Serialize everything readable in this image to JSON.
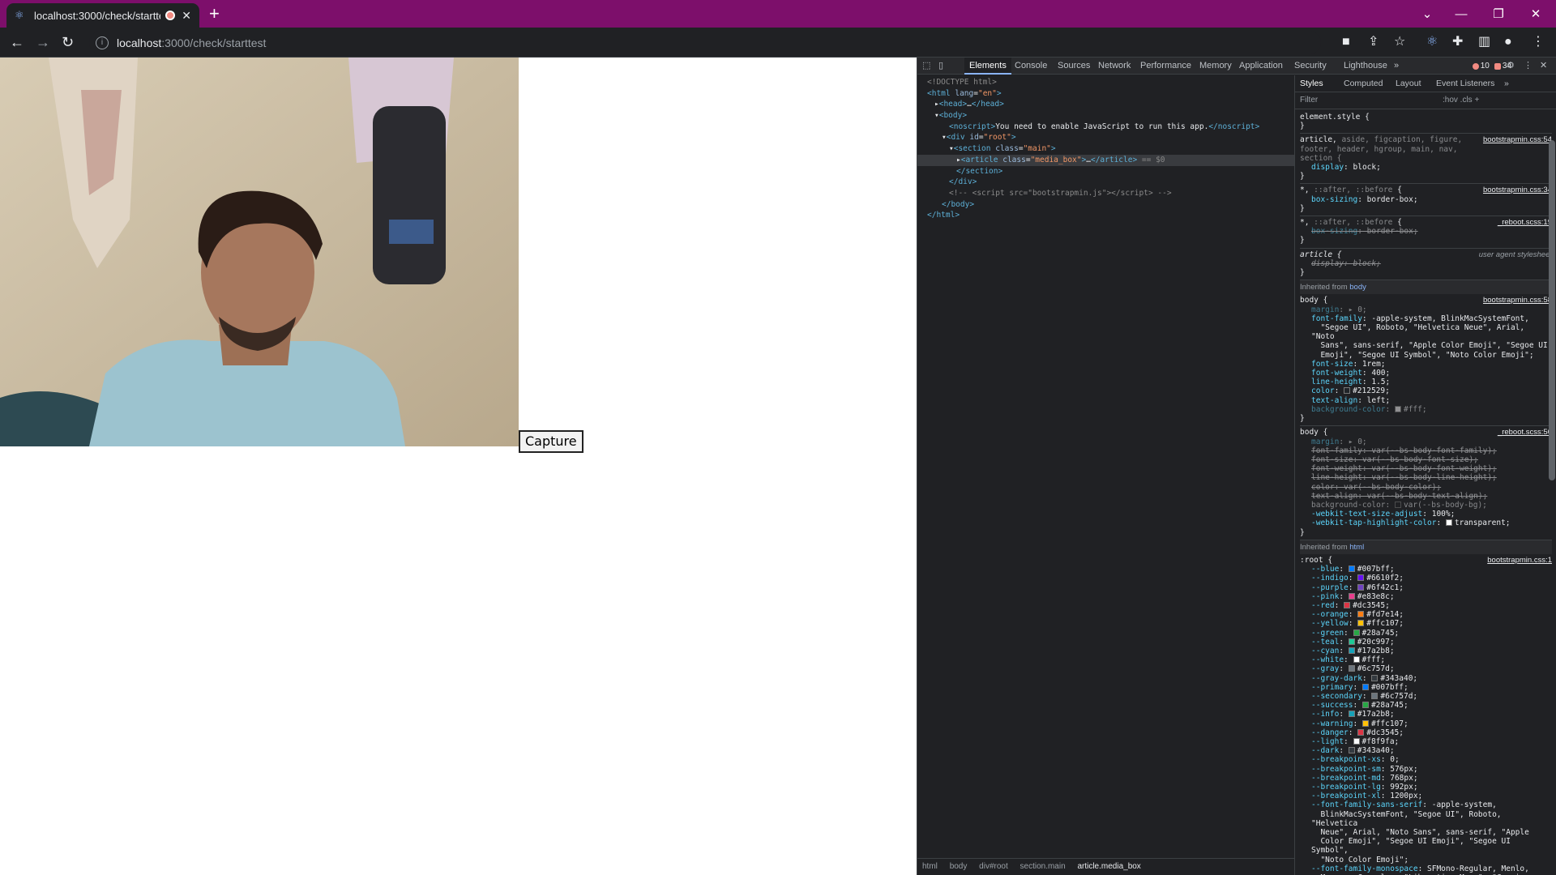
{
  "browser": {
    "tab_title": "localhost:3000/check/startte",
    "new_tab": "+",
    "url_host": "localhost",
    "url_path": ":3000/check/starttest"
  },
  "page": {
    "capture_label": "Capture"
  },
  "devtools": {
    "tabs": [
      "Elements",
      "Console",
      "Sources",
      "Network",
      "Performance",
      "Memory",
      "Application",
      "Security",
      "Lighthouse",
      "»"
    ],
    "errors": "10",
    "warnings": "34",
    "dom": [
      {
        "indent": 0,
        "html": "<span class='cm'>&lt;!DOCTYPE html&gt;</span>"
      },
      {
        "indent": 0,
        "html": "<span class='tag'>&lt;html</span> <span class='att'>lang</span>=<span class='val'>\"en\"</span><span class='tag'>&gt;</span>"
      },
      {
        "indent": 1,
        "html": "▸<span class='tag'>&lt;head&gt;</span>…<span class='tag'>&lt;/head&gt;</span>"
      },
      {
        "indent": 1,
        "html": "▾<span class='tag'>&lt;body&gt;</span>"
      },
      {
        "indent": 3,
        "html": "<span class='tag'>&lt;noscript&gt;</span><span class='txt'>You need to enable JavaScript to run this app.</span><span class='tag'>&lt;/noscript&gt;</span>"
      },
      {
        "indent": 2,
        "html": "▾<span class='tag'>&lt;div</span> <span class='att'>id</span>=<span class='val'>\"root\"</span><span class='tag'>&gt;</span>"
      },
      {
        "indent": 3,
        "html": "▾<span class='tag'>&lt;section</span> <span class='att'>class</span>=<span class='val'>\"main\"</span><span class='tag'>&gt;</span>"
      },
      {
        "indent": 4,
        "html": "▸<span class='tag'>&lt;article</span> <span class='att'>class</span>=<span class='val'>\"media_box\"</span><span class='tag'>&gt;</span>…<span class='tag'>&lt;/article&gt;</span> <span class='cm'>== $0</span>",
        "selected": true
      },
      {
        "indent": 4,
        "html": "<span class='tag'>&lt;/section&gt;</span>"
      },
      {
        "indent": 3,
        "html": "<span class='tag'>&lt;/div&gt;</span>"
      },
      {
        "indent": 3,
        "html": "<span class='cm'>&lt;!-- &lt;script src=\"bootstrapmin.js\"&gt;&lt;/script&gt; --&gt;</span>"
      },
      {
        "indent": 2,
        "html": "<span class='tag'>&lt;/body&gt;</span>"
      },
      {
        "indent": 0,
        "html": "<span class='tag'>&lt;/html&gt;</span>"
      }
    ],
    "breadcrumbs": [
      "html",
      "body",
      "div#root",
      "section.main",
      "article.media_box"
    ],
    "styles_tabs": [
      "Styles",
      "Computed",
      "Layout",
      "Event Listeners",
      "»"
    ],
    "filter_placeholder": "Filter",
    "filter_tools": ":hov .cls +"
  }
}
